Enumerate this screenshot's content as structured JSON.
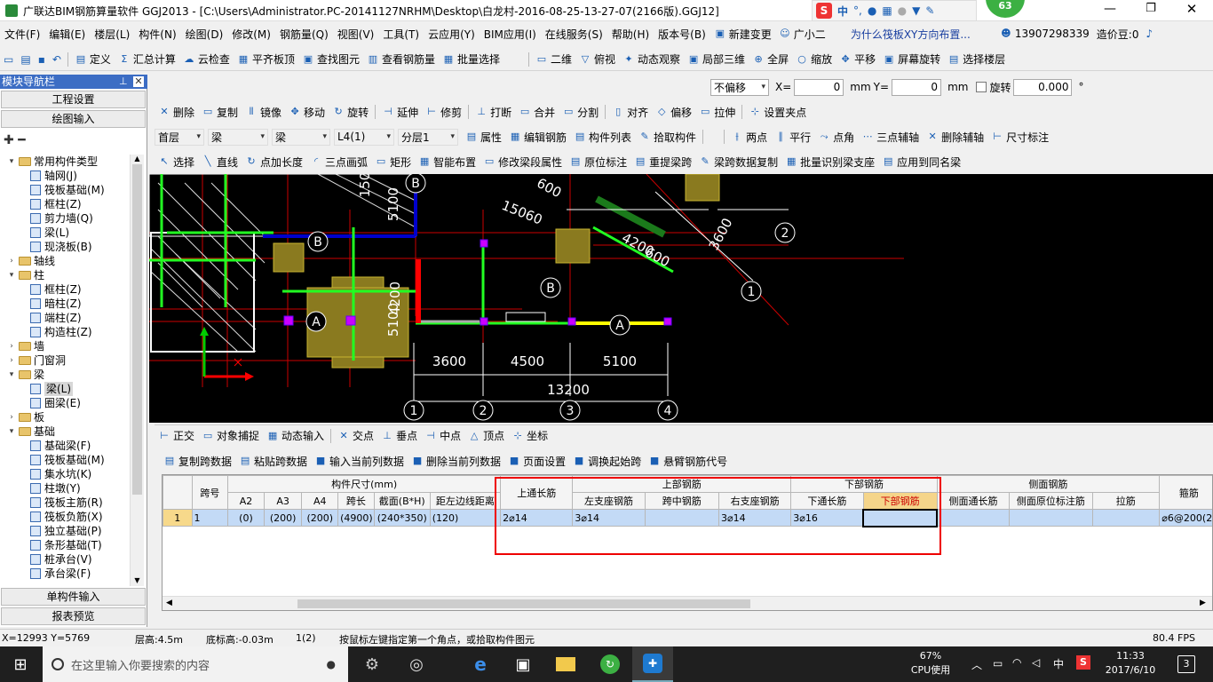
{
  "titlebar": {
    "title": "广联达BIM钢筋算量软件 GGJ2013 - [C:\\Users\\Administrator.PC-20141127NRHM\\Desktop\\白龙村-2016-08-25-13-27-07(2166版).GGJ12]",
    "ime_label": "中",
    "badge": "63"
  },
  "menubar": {
    "items": [
      "文件(F)",
      "编辑(E)",
      "楼层(L)",
      "构件(N)",
      "绘图(D)",
      "修改(M)",
      "钢筋量(Q)",
      "视图(V)",
      "工具(T)",
      "云应用(Y)",
      "BIM应用(I)",
      "在线服务(S)",
      "帮助(H)",
      "版本号(B)"
    ],
    "new_change": "新建变更",
    "assistant": "广小二",
    "question_link": "为什么筏板XY方向布置...",
    "phone": "13907298339",
    "beans": "造价豆:0"
  },
  "toolbar1": {
    "items": [
      "定义",
      "汇总计算",
      "云检查",
      "平齐板顶",
      "查找图元",
      "查看钢筋量",
      "批量选择"
    ],
    "items_right": [
      "二维",
      "俯视",
      "动态观察",
      "局部三维",
      "全屏",
      "缩放",
      "平移",
      "屏幕旋转",
      "选择楼层"
    ]
  },
  "nav_panel": {
    "title": "模块导航栏",
    "btn_project": "工程设置",
    "btn_draw": "绘图输入",
    "tree": [
      {
        "label": "常用构件类型",
        "level": 0,
        "type": "folder",
        "exp": "▾"
      },
      {
        "label": "轴网(J)",
        "level": 1,
        "type": "comp"
      },
      {
        "label": "筏板基础(M)",
        "level": 1,
        "type": "comp"
      },
      {
        "label": "框柱(Z)",
        "level": 1,
        "type": "comp"
      },
      {
        "label": "剪力墙(Q)",
        "level": 1,
        "type": "comp"
      },
      {
        "label": "梁(L)",
        "level": 1,
        "type": "comp"
      },
      {
        "label": "现浇板(B)",
        "level": 1,
        "type": "comp"
      },
      {
        "label": "轴线",
        "level": 0,
        "type": "folder",
        "exp": "›"
      },
      {
        "label": "柱",
        "level": 0,
        "type": "folder",
        "exp": "▾"
      },
      {
        "label": "框柱(Z)",
        "level": 1,
        "type": "comp"
      },
      {
        "label": "暗柱(Z)",
        "level": 1,
        "type": "comp"
      },
      {
        "label": "端柱(Z)",
        "level": 1,
        "type": "comp"
      },
      {
        "label": "构造柱(Z)",
        "level": 1,
        "type": "comp"
      },
      {
        "label": "墙",
        "level": 0,
        "type": "folder",
        "exp": "›"
      },
      {
        "label": "门窗洞",
        "level": 0,
        "type": "folder",
        "exp": "›"
      },
      {
        "label": "梁",
        "level": 0,
        "type": "folder",
        "exp": "▾"
      },
      {
        "label": "梁(L)",
        "level": 1,
        "type": "comp",
        "selected": true
      },
      {
        "label": "圈梁(E)",
        "level": 1,
        "type": "comp"
      },
      {
        "label": "板",
        "level": 0,
        "type": "folder",
        "exp": "›"
      },
      {
        "label": "基础",
        "level": 0,
        "type": "folder",
        "exp": "▾"
      },
      {
        "label": "基础梁(F)",
        "level": 1,
        "type": "comp"
      },
      {
        "label": "筏板基础(M)",
        "level": 1,
        "type": "comp"
      },
      {
        "label": "集水坑(K)",
        "level": 1,
        "type": "comp"
      },
      {
        "label": "柱墩(Y)",
        "level": 1,
        "type": "comp"
      },
      {
        "label": "筏板主筋(R)",
        "level": 1,
        "type": "comp"
      },
      {
        "label": "筏板负筋(X)",
        "level": 1,
        "type": "comp"
      },
      {
        "label": "独立基础(P)",
        "level": 1,
        "type": "comp"
      },
      {
        "label": "条形基础(T)",
        "level": 1,
        "type": "comp"
      },
      {
        "label": "桩承台(V)",
        "level": 1,
        "type": "comp"
      },
      {
        "label": "承台梁(F)",
        "level": 1,
        "type": "comp"
      }
    ],
    "btn_single": "单构件输入",
    "btn_report": "报表预览"
  },
  "coord_bar": {
    "mode": "不偏移",
    "x_label": "X=",
    "x_val": "0",
    "y_label": "Y=",
    "y_val": "0",
    "unit": "mm",
    "rot_label": "旋转",
    "rot_val": "0.000",
    "deg": "°"
  },
  "edit_toolbar": {
    "items": [
      "删除",
      "复制",
      "镜像",
      "移动",
      "旋转",
      "延伸",
      "修剪",
      "打断",
      "合并",
      "分割",
      "对齐",
      "偏移",
      "拉伸",
      "设置夹点"
    ]
  },
  "layer_toolbar": {
    "floor": "首层",
    "type1": "梁",
    "type2": "梁",
    "name": "L4(1)",
    "layer": "分层1",
    "items": [
      "属性",
      "编辑钢筋",
      "构件列表",
      "拾取构件"
    ],
    "axis_items": [
      "两点",
      "平行",
      "点角",
      "三点辅轴",
      "删除辅轴",
      "尺寸标注"
    ]
  },
  "draw_toolbar": {
    "items": [
      "选择",
      "直线",
      "点加长度",
      "三点画弧",
      "矩形",
      "智能布置",
      "修改梁段属性",
      "原位标注",
      "重提梁跨",
      "梁跨数据复制",
      "批量识别梁支座",
      "应用到同名梁"
    ]
  },
  "canvas": {
    "dims": [
      "3600",
      "4500",
      "5100",
      "13200",
      "4200",
      "600",
      "3600",
      "5100",
      "150",
      "15060",
      "600",
      "4200",
      "5100"
    ],
    "axis_nums": [
      "1",
      "2",
      "3",
      "4",
      "1",
      "2"
    ],
    "axis_letters": [
      "A",
      "A",
      "B",
      "B",
      "B"
    ]
  },
  "snap_toolbar": {
    "items": [
      "正交",
      "对象捕捉",
      "动态输入",
      "交点",
      "垂点",
      "中点",
      "顶点",
      "坐标"
    ]
  },
  "table_toolbar": {
    "items": [
      "复制跨数据",
      "粘贴跨数据",
      "输入当前列数据",
      "删除当前列数据",
      "页面设置",
      "调换起始跨",
      "悬臂钢筋代号"
    ]
  },
  "grid": {
    "h_span": "跨号",
    "h_size": "构件尺寸(mm)",
    "h_top": "上通长筋",
    "h_upper": "上部钢筋",
    "h_lower": "下部钢筋",
    "h_side": "侧面钢筋",
    "h_stirrup": "箍筋",
    "sub": [
      "A2",
      "A3",
      "A4",
      "跨长",
      "截面(B*H)",
      "距左边线距离",
      "左支座钢筋",
      "跨中钢筋",
      "右支座钢筋",
      "下通长筋",
      "下部钢筋",
      "侧面通长筋",
      "侧面原位标注筋",
      "拉筋"
    ],
    "row": {
      "idx": "1",
      "span": "1",
      "a2": "(0)",
      "a3": "(200)",
      "a4": "(200)",
      "len": "(4900)",
      "sec": "(240*350)",
      "dist": "(120)",
      "top": "2⌀14",
      "left": "3⌀14",
      "mid": "",
      "right": "3⌀14",
      "bot_through": "3⌀16",
      "bot": "",
      "side_through": "",
      "side_in": "",
      "tie": "",
      "stirrup": "⌀6@200(2)"
    }
  },
  "statusbar": {
    "coords": "X=12993 Y=5769",
    "floor_h": "层高:4.5m",
    "base_h": "底标高:-0.03m",
    "count": "1(2)",
    "hint": "按鼠标左键指定第一个角点，或拾取构件图元",
    "fps": "80.4 FPS"
  },
  "taskbar": {
    "search": "在这里输入你要搜索的内容",
    "cpu_pct": "67%",
    "cpu_label": "CPU使用",
    "ime": "中",
    "time": "11:33",
    "date": "2017/6/10",
    "notif": "3"
  }
}
